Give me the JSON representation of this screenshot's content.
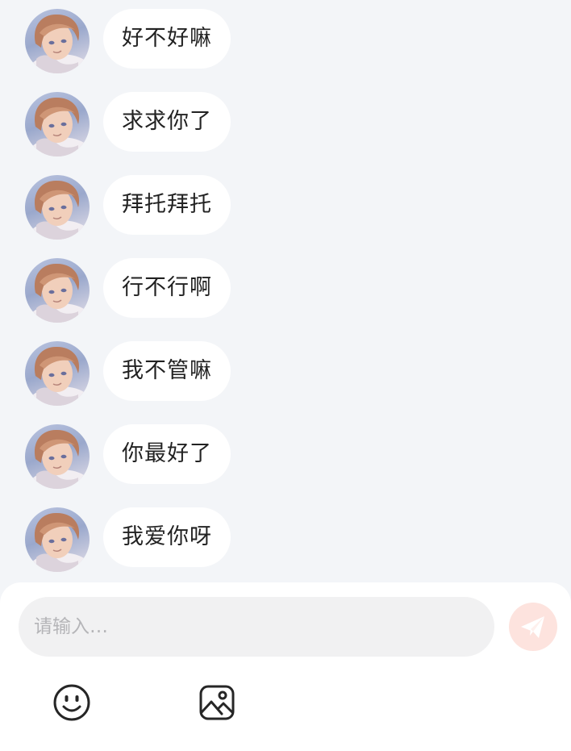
{
  "messages": [
    {
      "text": "好不好嘛"
    },
    {
      "text": "求求你了"
    },
    {
      "text": "拜托拜托"
    },
    {
      "text": "行不行啊"
    },
    {
      "text": "我不管嘛"
    },
    {
      "text": "你最好了"
    },
    {
      "text": "我爱你呀"
    }
  ],
  "composer": {
    "placeholder": "请输入…",
    "value": "",
    "send_icon": "paper-plane-icon",
    "tools": [
      {
        "icon": "smiley-face-icon"
      },
      {
        "icon": "image-icon"
      }
    ]
  },
  "colors": {
    "background": "#f3f5f8",
    "bubble": "#ffffff",
    "panel": "#ffffff",
    "input": "#f1f1f2",
    "send_button": "#fde3de",
    "send_icon": "#ffffff"
  }
}
